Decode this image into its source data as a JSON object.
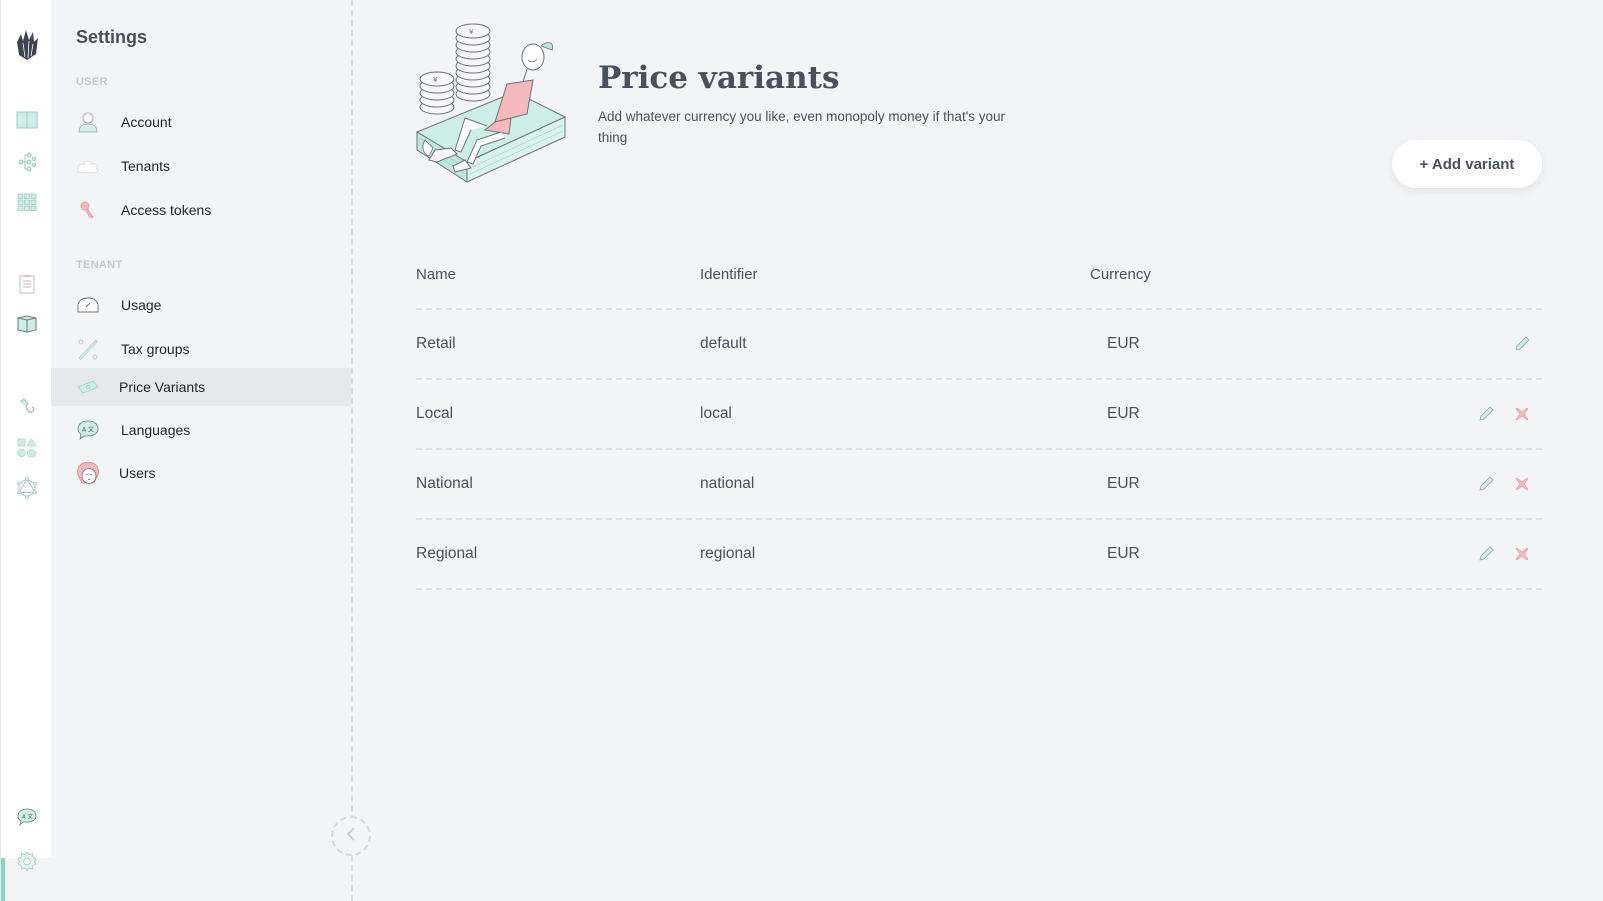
{
  "rail": {
    "items": [
      {
        "icon": "logo-icon"
      },
      {
        "icon": "catalogue-book-icon"
      },
      {
        "icon": "tree-icon"
      },
      {
        "icon": "grid-icon"
      },
      {
        "icon": "orders-clipboard-icon"
      },
      {
        "icon": "product-box-icon"
      },
      {
        "icon": "webhook-icon"
      },
      {
        "icon": "shapes-icon"
      },
      {
        "icon": "graphql-icon"
      },
      {
        "icon": "language-icon"
      },
      {
        "icon": "settings-gear-icon"
      }
    ],
    "accent_color": "#8ad3c2"
  },
  "sidebar": {
    "title": "Settings",
    "sections": [
      {
        "label": "USER",
        "items": [
          {
            "label": "Account",
            "icon": "user-icon"
          },
          {
            "label": "Tenants",
            "icon": "cloud-icon"
          },
          {
            "label": "Access tokens",
            "icon": "key-icon"
          }
        ]
      },
      {
        "label": "TENANT",
        "items": [
          {
            "label": "Usage",
            "icon": "gauge-icon"
          },
          {
            "label": "Tax groups",
            "icon": "percent-icon"
          },
          {
            "label": "Price Variants",
            "icon": "banknote-icon",
            "active": true
          },
          {
            "label": "Languages",
            "icon": "language-bubble-icon"
          },
          {
            "label": "Users",
            "icon": "users-avatar-icon"
          }
        ]
      }
    ],
    "collapse_icon": "chevron-left-icon"
  },
  "header": {
    "title": "Price variants",
    "description": "Add whatever currency you like, even monopoly money if that's your thing",
    "add_button": "+ Add variant"
  },
  "table": {
    "columns": [
      "Name",
      "Identifier",
      "Currency"
    ],
    "rows": [
      {
        "name": "Retail",
        "identifier": "default",
        "currency": "EUR",
        "deletable": false
      },
      {
        "name": "Local",
        "identifier": "local",
        "currency": "EUR",
        "deletable": true
      },
      {
        "name": "National",
        "identifier": "national",
        "currency": "EUR",
        "deletable": true
      },
      {
        "name": "Regional",
        "identifier": "regional",
        "currency": "EUR",
        "deletable": true
      }
    ]
  },
  "colors": {
    "mint": "#cdeee6",
    "mint_stroke": "#8fbfb3",
    "pink": "#f4b8bd",
    "text": "#4a4f5a"
  }
}
